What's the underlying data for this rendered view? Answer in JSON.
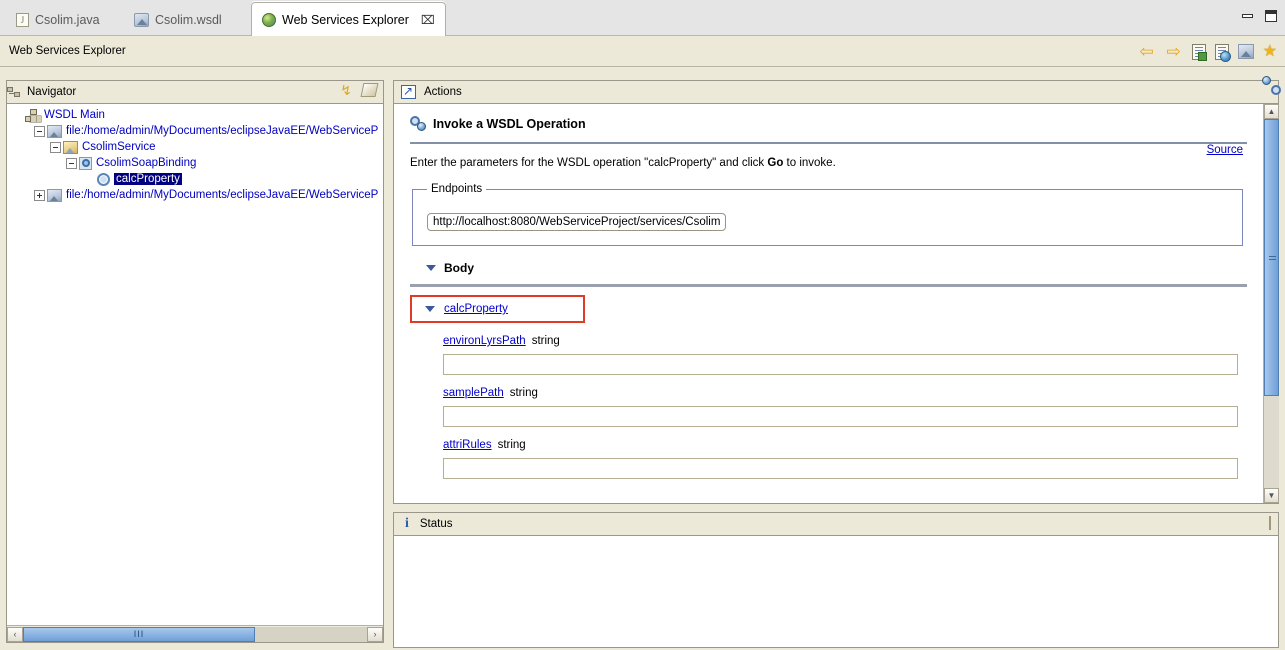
{
  "window": {
    "minimize_label": "minimize",
    "maximize_label": "maximize"
  },
  "tabs": [
    {
      "label": "Csolim.java",
      "icon": "java-file-icon",
      "active": false,
      "closable": false
    },
    {
      "label": "Csolim.wsdl",
      "icon": "wsdl-file-icon",
      "active": false,
      "closable": false
    },
    {
      "label": "Web Services Explorer",
      "icon": "globe-icon",
      "active": true,
      "closable": true,
      "close_glyph": "⌧"
    }
  ],
  "explorer_toolbar": {
    "title": "Web Services Explorer",
    "icons": [
      {
        "name": "back-arrow-icon",
        "glyph": "⇦"
      },
      {
        "name": "forward-arrow-icon",
        "glyph": "⇨"
      },
      {
        "name": "wsdl-page-icon",
        "glyph": ""
      },
      {
        "name": "uddi-page-icon",
        "glyph": ""
      },
      {
        "name": "wsil-page-icon",
        "glyph": ""
      },
      {
        "name": "favorites-star-icon",
        "glyph": "★"
      }
    ]
  },
  "navigator": {
    "title": "Navigator",
    "header_icons": [
      {
        "name": "navigator-view-icon"
      },
      {
        "name": "refresh-icon",
        "glyph": "↯"
      },
      {
        "name": "clear-eraser-icon"
      }
    ],
    "tree": [
      {
        "label": "WSDL Main",
        "icon": "wsdl-main-icon",
        "indent": 0,
        "twisty": "none",
        "selected": false
      },
      {
        "label": "file:/home/admin/MyDocuments/eclipseJavaEE/WebServiceP",
        "icon": "wsdl-file-icon",
        "indent": 1,
        "twisty": "minus",
        "selected": false
      },
      {
        "label": "CsolimService",
        "icon": "service-icon",
        "indent": 2,
        "twisty": "minus",
        "selected": false
      },
      {
        "label": "CsolimSoapBinding",
        "icon": "binding-icon",
        "indent": 3,
        "twisty": "minus",
        "selected": false
      },
      {
        "label": "calcProperty",
        "icon": "operation-gear-icon",
        "indent": 4,
        "twisty": "none",
        "selected": true
      },
      {
        "label": "file:/home/admin/MyDocuments/eclipseJavaEE/WebServiceP",
        "icon": "wsdl-file-icon",
        "indent": 1,
        "twisty": "plus",
        "selected": false
      }
    ],
    "hscrollbar": {
      "left_glyph": "‹",
      "right_glyph": "›",
      "thumb_glyph": "III"
    }
  },
  "actions": {
    "title": "Actions",
    "corner_icon": "wsdl-operation-icon",
    "operation_title": "Invoke a WSDL Operation",
    "source_link": "Source",
    "instruction_prefix": "Enter the parameters for the WSDL operation \"calcProperty\" and click ",
    "instruction_bold": "Go",
    "instruction_suffix": " to invoke.",
    "endpoints": {
      "legend": "Endpoints",
      "value": "http://localhost:8080/WebServiceProject/services/Csolim"
    },
    "body_section": {
      "label": "Body",
      "operation_name": "calcProperty",
      "highlight_color": "#e03b28",
      "parameters": [
        {
          "name": "environLyrsPath",
          "type": "string",
          "value": ""
        },
        {
          "name": "samplePath",
          "type": "string",
          "value": ""
        },
        {
          "name": "attriRules",
          "type": "string",
          "value": ""
        }
      ]
    },
    "vscrollbar": {
      "up_glyph": "▲",
      "down_glyph": "▼"
    }
  },
  "status": {
    "title": "Status",
    "info_glyph": "i",
    "corner_icon": "clear-eraser-icon",
    "content": ""
  },
  "colors": {
    "chrome": "#ece9d8",
    "selection": "#000080",
    "link": "#0000cc",
    "highlight_border": "#e03b28",
    "scroll_thumb": "#6f9fd8"
  }
}
